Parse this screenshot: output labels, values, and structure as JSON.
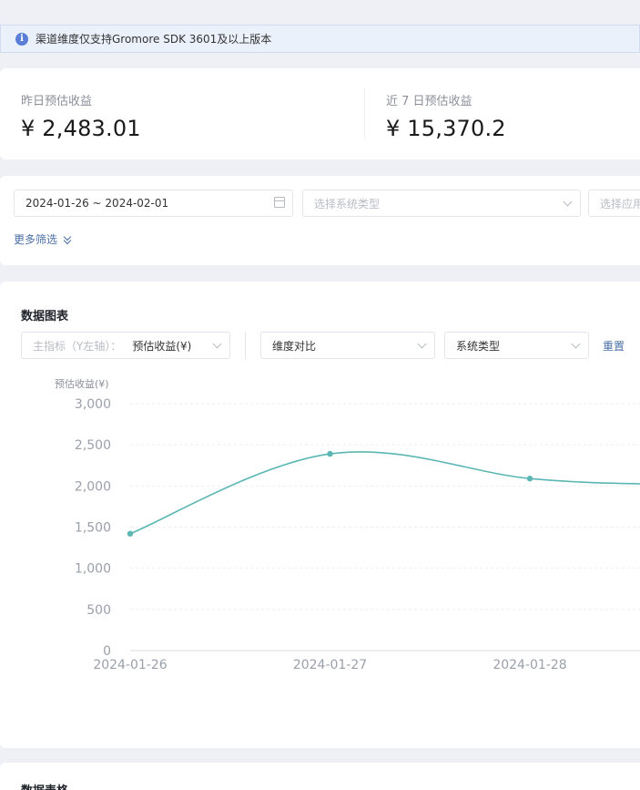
{
  "notice": {
    "text": "渠道维度仅支持Gromore SDK 3601及以上版本"
  },
  "stats": {
    "yesterday": {
      "label": "昨日预估收益",
      "value": "¥ 2,483.01"
    },
    "last7": {
      "label": "近 7 日预估收益",
      "value": "¥ 15,370.2"
    }
  },
  "filters": {
    "date_range": "2024-01-26 ~ 2024-02-01",
    "system_type_placeholder": "选择系统类型",
    "app_placeholder": "选择应用",
    "more_label": "更多筛选"
  },
  "chart_section": {
    "title": "数据图表",
    "metric_label": "主指标（Y左轴）：",
    "metric_value": "预估收益(¥)",
    "dimension_compare": "维度对比",
    "system_type": "系统类型",
    "reset_label": "重置"
  },
  "chart_data": {
    "type": "line",
    "ylabel": "预估收益(¥)",
    "ylim": [
      0,
      3000
    ],
    "yticks": [
      "0",
      "500",
      "1,000",
      "1,500",
      "2,000",
      "2,500",
      "3,000"
    ],
    "categories": [
      "2024-01-26",
      "2024-01-27",
      "2024-01-28"
    ],
    "values": [
      1420,
      2390,
      2090
    ],
    "trailing_value": 2020,
    "color": "#5bb6b4",
    "grid": true
  },
  "table_section": {
    "title": "数据表格"
  }
}
